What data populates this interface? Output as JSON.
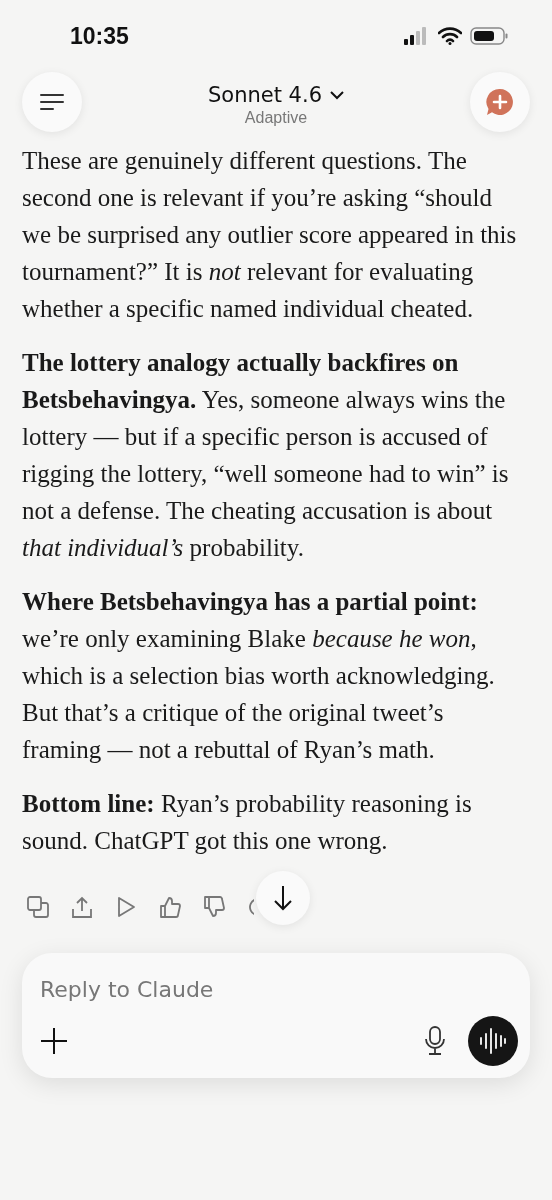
{
  "status_bar": {
    "time": "10:35"
  },
  "header": {
    "title": "Sonnet 4.6",
    "subtitle": "Adaptive"
  },
  "message": {
    "paragraphs": [
      "These are genuinely different questions. The second one is relevant if you’re asking “should we be surprised any outlier score appeared in this tournament?” It is *not* relevant for evaluating whether a specific named individual cheated.",
      "**The lottery analogy actually backfires on Betsbehavingya.** Yes, someone always wins the lottery — but if a specific person is accused of rigging the lottery, “well someone had to win” is not a defense. The cheating accusation is about *that individual’s* probability.",
      "**Where Betsbehavingya has a partial point:** we’re only examining Blake *because he won*, which is a selection bias worth acknowledging. But that’s a critique of the original tweet’s framing — not a rebuttal of Ryan’s math.",
      "**Bottom line:** Ryan’s probability reasoning is sound. ChatGPT got this one wrong."
    ]
  },
  "composer": {
    "placeholder": "Reply to Claude"
  }
}
